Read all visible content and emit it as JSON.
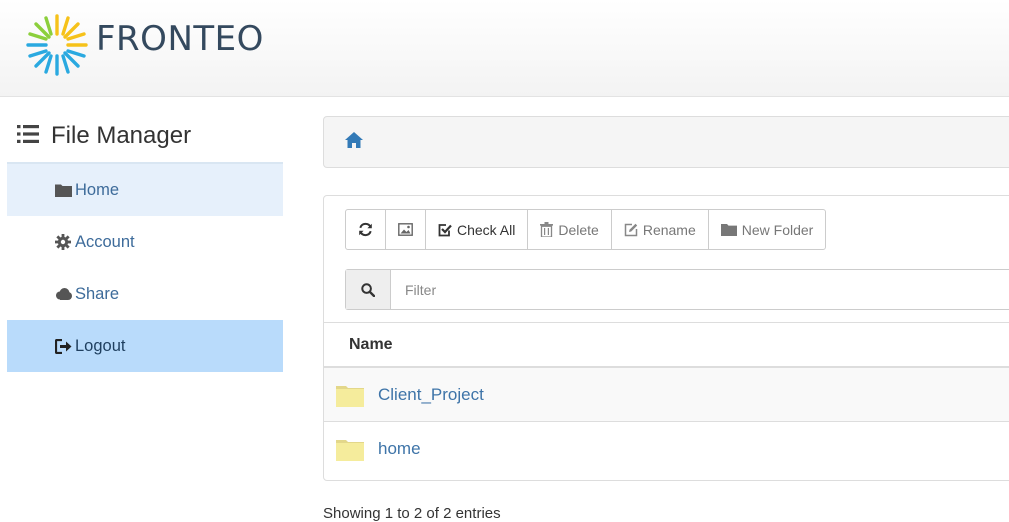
{
  "header": {
    "logo_text": "FRONTEO"
  },
  "sidebar": {
    "title": "File Manager",
    "items": [
      {
        "label": "Home",
        "icon": "folder-icon"
      },
      {
        "label": "Account",
        "icon": "gear-icon"
      },
      {
        "label": "Share",
        "icon": "cloud-icon"
      },
      {
        "label": "Logout",
        "icon": "sign-out-icon"
      }
    ]
  },
  "breadcrumb": {
    "icon": "home-icon"
  },
  "toolbar": {
    "refresh_icon": "refresh-icon",
    "image_icon": "image-icon",
    "check_all": "Check All",
    "delete": "Delete",
    "rename": "Rename",
    "new_folder": "New Folder"
  },
  "filter": {
    "placeholder": "Filter",
    "value": ""
  },
  "table": {
    "columns": [
      "Name"
    ],
    "rows": [
      {
        "name": "Client_Project",
        "icon": "folder-icon"
      },
      {
        "name": "home",
        "icon": "folder-icon"
      }
    ]
  },
  "footer": {
    "showing": "Showing 1 to 2 of 2 entries"
  },
  "colors": {
    "accent": "#3e74a8",
    "active": "#b9dbfb",
    "home_bg": "#e6f0fb"
  }
}
